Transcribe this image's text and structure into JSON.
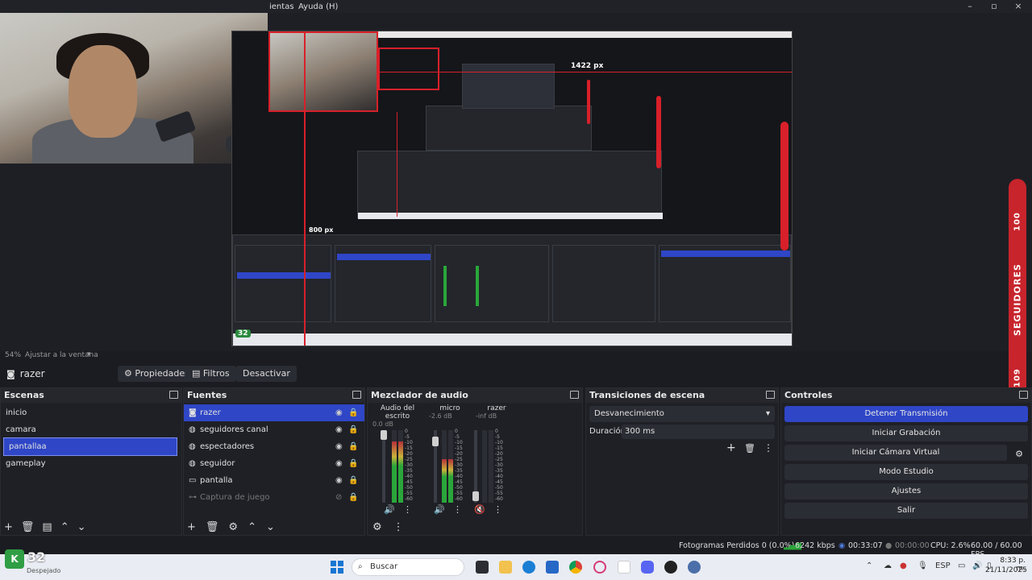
{
  "menubar": {
    "items": [
      "ientas",
      "Ayuda (H)"
    ]
  },
  "window": {
    "minimize": "–",
    "maximize": "▫",
    "close": "×"
  },
  "preview": {
    "nested_labels": {
      "px1": "1422 px",
      "px2": "800 px",
      "seguidores": "SEGUIDORES",
      "num": "100"
    }
  },
  "side_badge": {
    "top": "100",
    "label": "SEGUIDORES",
    "bottom": "109"
  },
  "zoom": {
    "percent": "54%",
    "fit": "Ajustar a la ventana"
  },
  "source_bar": {
    "name": "razer",
    "propiedades": "Propiedades",
    "filtros": "Filtros",
    "desactivar": "Desactivar"
  },
  "scenes": {
    "title": "Escenas",
    "items": [
      "inicio",
      "camara",
      "pantallaa",
      "gameplay"
    ]
  },
  "sources": {
    "title": "Fuentes",
    "items": [
      "razer",
      "seguidores canal",
      "espectadores",
      "seguidor",
      "pantalla",
      "Captura de juego"
    ]
  },
  "mixer": {
    "title": "Mezclador de audio",
    "channels": [
      {
        "name": "Audio del escrito",
        "db": "0.0 dB",
        "level": 0.85
      },
      {
        "name": "micro",
        "db": "-2.6 dB",
        "level": 0.6
      },
      {
        "name": "razer",
        "db": "-inf dB",
        "level": 0.0
      }
    ],
    "scale": [
      "0",
      "-5",
      "-10",
      "-15",
      "-20",
      "-25",
      "-30",
      "-35",
      "-40",
      "-45",
      "-50",
      "-55",
      "-60"
    ]
  },
  "transitions": {
    "title": "Transiciones de escena",
    "selected": "Desvanecimiento",
    "duration_label": "Duración",
    "duration_value": "300 ms"
  },
  "controls": {
    "title": "Controles",
    "buttons": [
      "Detener Transmisión",
      "Iniciar Grabación",
      "Iniciar Cámara Virtual",
      "Modo Estudio",
      "Ajustes",
      "Salir"
    ]
  },
  "status": {
    "dropped": "Fotogramas Perdidos 0 (0.0%)",
    "kbps": "6242 kbps",
    "stream_time": "00:33:07",
    "rec_time": "00:00:00",
    "cpu": "CPU: 2.6%",
    "fps": "60.00 / 60.00 FPS"
  },
  "taskbar": {
    "weather_temp": "32",
    "weather_desc": "Despejado",
    "search": "Buscar",
    "lang": "ESP",
    "time": "8:33 p. m.",
    "date": "21/11/2025"
  },
  "colors": {
    "accent": "#2f46c7",
    "red": "#d8202a",
    "green": "#2aa63a"
  }
}
